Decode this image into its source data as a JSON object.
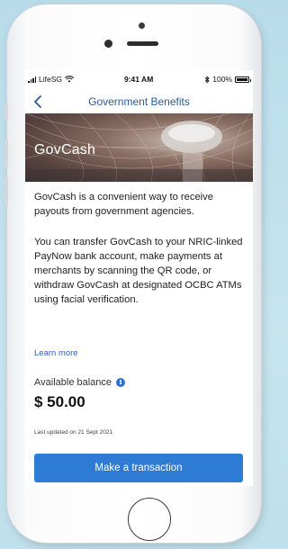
{
  "status_bar": {
    "carrier": "LifeSG",
    "time": "9:41 AM",
    "battery_percent": "100%"
  },
  "nav": {
    "title": "Government Benefits",
    "back_icon": "chevron-left-icon"
  },
  "hero": {
    "title": "GovCash"
  },
  "content": {
    "paragraph_1": "GovCash is a convenient way to receive payouts from government agencies.",
    "paragraph_2": "You can transfer GovCash to your NRIC-linked PayNow bank account, make payments at merchants by scanning the QR code, or withdraw GovCash at designated OCBC ATMs using facial verification.",
    "learn_more": "Learn more"
  },
  "balance": {
    "label": "Available balance",
    "info_icon": "i",
    "value": "$ 50.00",
    "updated": "Last updated on 21 Sept 2021"
  },
  "cta": {
    "label": "Make a transaction"
  },
  "colors": {
    "accent": "#2e7bd6",
    "nav_title": "#2a5c9a",
    "link": "#2a66b8"
  }
}
